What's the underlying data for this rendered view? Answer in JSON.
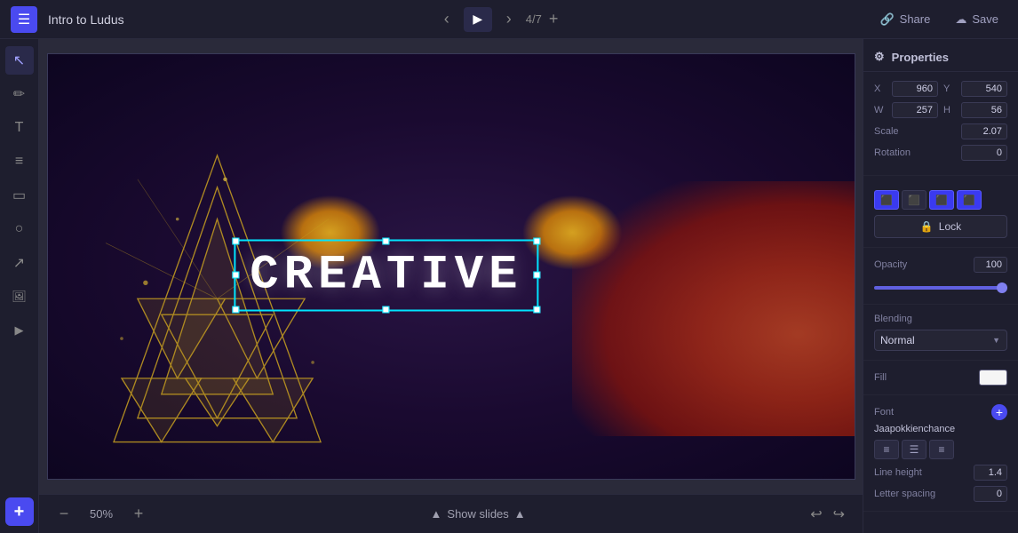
{
  "topbar": {
    "title": "Intro to Ludus",
    "slide_counter": "4/7",
    "share_label": "Share",
    "save_label": "Save"
  },
  "canvas": {
    "creative_text": "CREATIVE",
    "zoom": "50%"
  },
  "bottom": {
    "show_slides_label": "Show slides"
  },
  "properties": {
    "header_label": "Properties",
    "x": "960",
    "y": "540",
    "w": "257",
    "h": "56",
    "scale_label": "Scale",
    "scale_value": "2.07",
    "rotation_label": "Rotation",
    "rotation_value": "0",
    "lock_label": "Lock",
    "opacity_label": "Opacity",
    "opacity_value": "100",
    "blending_label": "Blending",
    "blending_value": "Normal",
    "fill_label": "Fill",
    "font_label": "Font",
    "font_name": "Jaapokkienchance",
    "line_height_label": "Line height",
    "line_height_value": "1.4",
    "letter_spacing_label": "Letter spacing",
    "letter_spacing_value": "0",
    "align_options": [
      "left",
      "center",
      "right"
    ]
  },
  "icons": {
    "menu": "☰",
    "arrow_left": "‹",
    "arrow_right": "›",
    "play": "▶",
    "plus": "+",
    "cursor": "↖",
    "pen": "✏",
    "text": "T",
    "lines": "≡",
    "rect": "▭",
    "circle": "○",
    "arrow_diag": "↗",
    "image": "🖼",
    "video": "▶",
    "add_plus": "+",
    "share_icon": "🔗",
    "save_icon": "💾",
    "undo": "↩",
    "redo": "↪",
    "chevron_up": "▲",
    "chevron_down": "▼",
    "lock": "🔒",
    "gear": "⚙"
  }
}
